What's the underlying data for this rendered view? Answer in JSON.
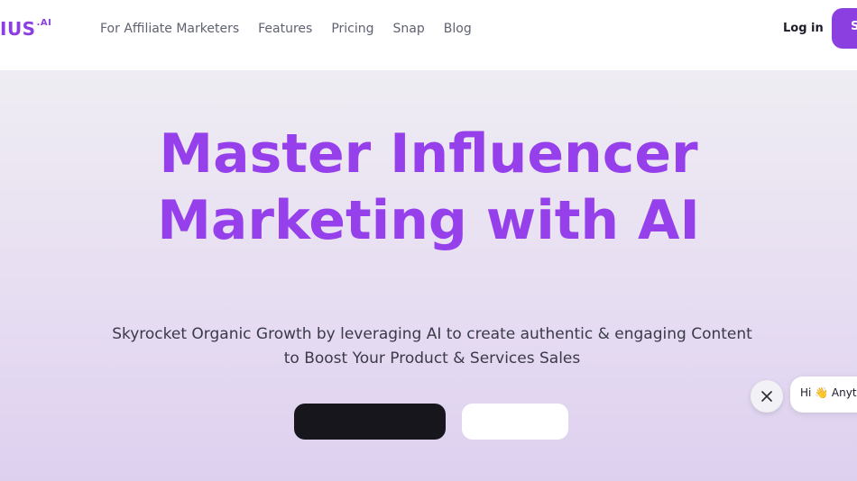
{
  "header": {
    "logo_text": "IUS",
    "logo_suffix": ".AI",
    "nav": [
      {
        "label": "For Affiliate Marketers"
      },
      {
        "label": "Features"
      },
      {
        "label": "Pricing"
      },
      {
        "label": "Snap"
      },
      {
        "label": "Blog"
      }
    ],
    "login_label": "Log in",
    "cta_label": "S"
  },
  "hero": {
    "headline_line1": "Master Influencer",
    "headline_line2": "Marketing with AI",
    "subtitle_line1": "Skyrocket Organic Growth by leveraging AI to create authentic & engaging Content",
    "subtitle_line2": "to Boost Your Product & Services Sales"
  },
  "chat": {
    "close_icon": "close-icon",
    "greeting": "Hi 👋 Anyt"
  },
  "colors": {
    "accent": "#9640ec",
    "brand": "#8b3fe0",
    "dark_button": "#16161c"
  }
}
